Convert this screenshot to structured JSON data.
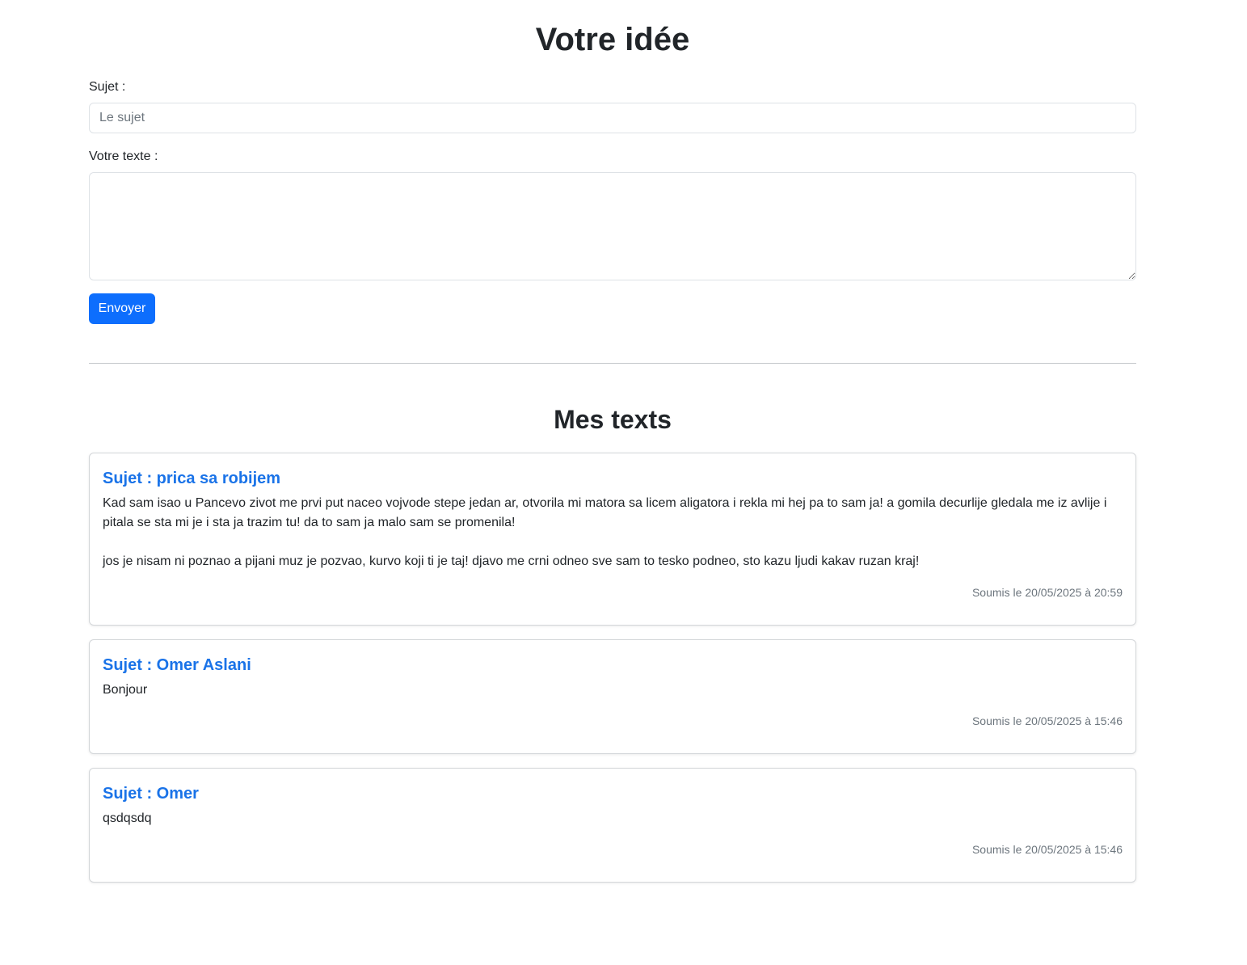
{
  "form": {
    "title": "Votre idée",
    "subject_label": "Sujet :",
    "subject_placeholder": "Le sujet",
    "subject_value": "",
    "text_label": "Votre texte :",
    "text_value": "",
    "submit_label": "Envoyer"
  },
  "list": {
    "title": "Mes texts",
    "items": [
      {
        "subject": "Sujet : prica sa robijem",
        "text": "Kad sam isao u Pancevo zivot me prvi put naceo vojvode stepe jedan ar, otvorila mi matora sa licem aligatora i rekla mi hej pa to sam ja! a gomila decurlije gledala me iz avlije i pitala se sta mi je i sta ja trazim tu! da to sam ja malo sam se promenila!\n\njos je nisam ni poznao a pijani muz je pozvao, kurvo koji ti je taj! djavo me crni odneo sve sam to tesko podneo, sto kazu ljudi kakav ruzan kraj!",
        "date": "Soumis le 20/05/2025 à 20:59"
      },
      {
        "subject": "Sujet : Omer Aslani",
        "text": "Bonjour",
        "date": "Soumis le 20/05/2025 à 15:46"
      },
      {
        "subject": "Sujet : Omer",
        "text": "qsdqsdq",
        "date": "Soumis le 20/05/2025 à 15:46"
      }
    ]
  },
  "colors": {
    "primary": "#0d6efd",
    "card_title": "#1a73e8",
    "muted": "#6c757d",
    "border": "#dee2e6"
  }
}
